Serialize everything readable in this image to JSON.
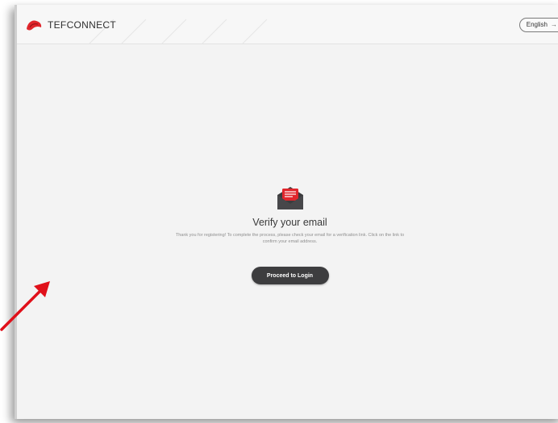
{
  "header": {
    "brand": "TEFCONNECT",
    "language": "English"
  },
  "main": {
    "title": "Verify your email",
    "description": "Thank you for registering! To complete the process, please check your email for a verification link. Click on the link to confirm your email address.",
    "login_button": "Proceed to Login"
  },
  "icons": {
    "brand_logo": "tefconnect-logo-icon",
    "language_arrow": "arrow-right-icon",
    "envelope": "open-envelope-icon",
    "annotation": "red-arrow-annotation"
  },
  "colors": {
    "accent": "#e0262c",
    "button": "#3d3d3f",
    "background": "#f3f3f3"
  }
}
